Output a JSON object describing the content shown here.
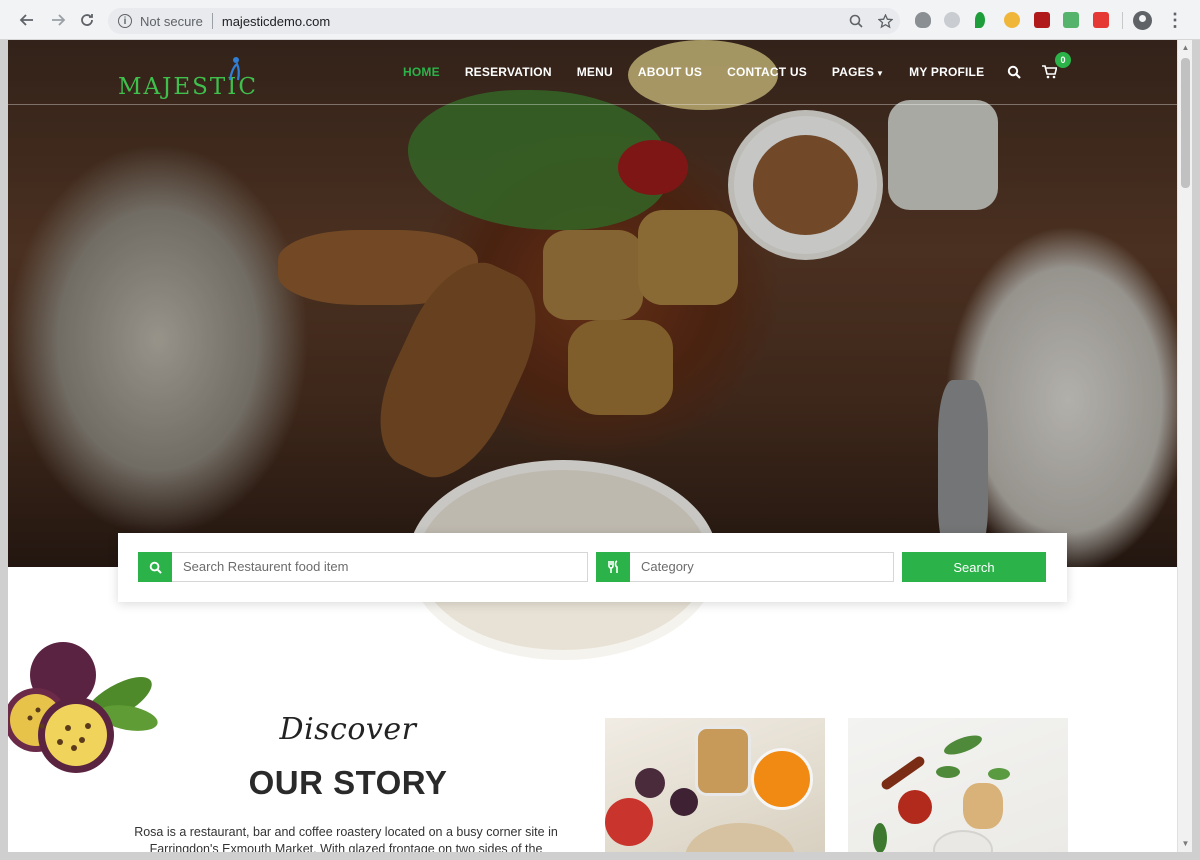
{
  "browser": {
    "security_label": "Not secure",
    "url": "majesticdemo.com",
    "back_icon": "back-arrow-icon",
    "forward_icon": "forward-arrow-icon",
    "reload_icon": "reload-icon"
  },
  "site": {
    "logo_text": "MAJESTIC",
    "nav": [
      {
        "label": "HOME",
        "active": true
      },
      {
        "label": "RESERVATION"
      },
      {
        "label": "MENU"
      },
      {
        "label": "ABOUT US"
      },
      {
        "label": "CONTACT US"
      },
      {
        "label": "PAGES"
      },
      {
        "label": "MY PROFILE"
      }
    ],
    "cart_count": "0",
    "accent_color": "#2bb34a"
  },
  "search": {
    "food_placeholder": "Search Restaurent food item",
    "category_placeholder": "Category",
    "button_label": "Search"
  },
  "story": {
    "kicker": "Discover",
    "title": "OUR STORY",
    "text": "Rosa is a restaurant, bar and coffee roastery located on a busy corner site in Farringdon's Exmouth Market. With glazed frontage on two sides of the"
  }
}
